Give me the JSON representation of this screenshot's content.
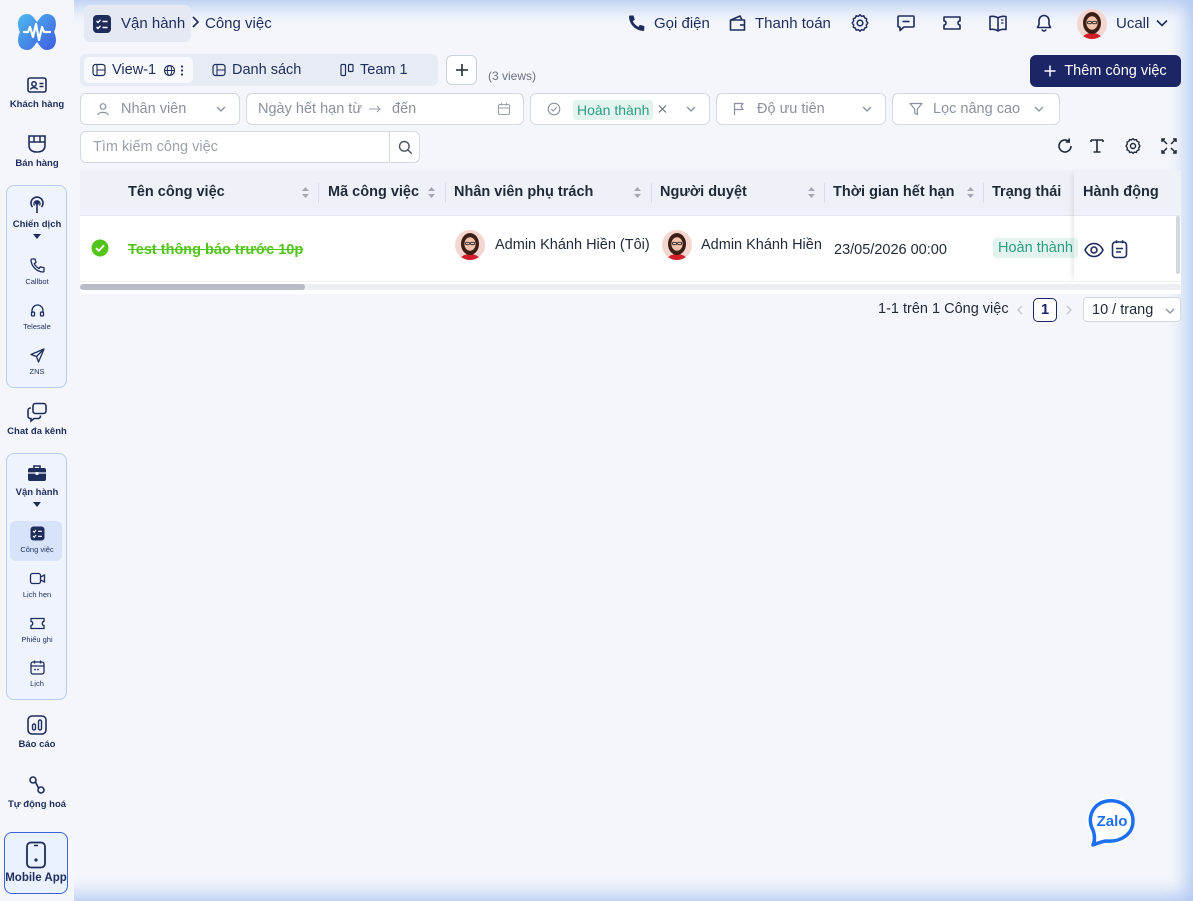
{
  "sidebar": {
    "items": [
      {
        "label": "Khách hàng",
        "icon": "contact-card-icon"
      },
      {
        "label": "Bán hàng",
        "icon": "store-icon"
      },
      {
        "label": "Chiến dịch",
        "icon": "broadcast-icon"
      },
      {
        "label": "Chat đa kênh",
        "icon": "chat-icon"
      },
      {
        "label": "Vận hành",
        "icon": "briefcase-icon"
      },
      {
        "label": "Báo cáo",
        "icon": "report-icon"
      },
      {
        "label": "Tự động hoá",
        "icon": "automation-icon"
      }
    ],
    "campaign_sub": [
      {
        "label": "Callbot",
        "icon": "phone-icon"
      },
      {
        "label": "Telesale",
        "icon": "headset-icon"
      },
      {
        "label": "ZNS",
        "icon": "send-icon"
      }
    ],
    "operation_sub": [
      {
        "label": "Công việc",
        "icon": "checklist-icon",
        "active": true
      },
      {
        "label": "Lịch hẹn",
        "icon": "video-icon"
      },
      {
        "label": "Phiếu ghi",
        "icon": "ticket-icon"
      },
      {
        "label": "Lịch",
        "icon": "calendar-icon"
      }
    ],
    "mobile_app": "Mobile App"
  },
  "header": {
    "breadcrumb_main": "Vận hành",
    "breadcrumb_sub": "Công việc",
    "call_label": "Gọi điện",
    "payment_label": "Thanh toán",
    "user_name": "Ucall"
  },
  "views": {
    "tabs": [
      {
        "label": "View-1",
        "active": true
      },
      {
        "label": "Danh sách"
      },
      {
        "label": "Team 1"
      }
    ],
    "count_label": "(3 views)",
    "add_task_label": "Thêm công việc"
  },
  "filters": {
    "employee_placeholder": "Nhân viên",
    "date_from_placeholder": "Ngày hết hạn từ",
    "date_to_placeholder": "đến",
    "status_value": "Hoàn thành",
    "priority_placeholder": "Độ ưu tiên",
    "advanced_label": "Lọc nâng cao",
    "search_placeholder": "Tìm kiếm công việc"
  },
  "table": {
    "columns": [
      "Tên công việc",
      "Mã công việc",
      "Nhân viên phụ trách",
      "Người duyệt",
      "Thời gian hết hạn",
      "Trạng thái",
      "Hành động"
    ],
    "rows": [
      {
        "name": "Test thông báo trước 10p",
        "code": "",
        "assignee": "Admin Khánh Hiền (Tôi)",
        "approver": "Admin Khánh Hiền",
        "deadline": "23/05/2026 00:00",
        "status": "Hoàn thành"
      }
    ]
  },
  "pagination": {
    "summary": "1-1 trên 1 Công việc",
    "current_page": "1",
    "page_size": "10 / trang"
  },
  "colors": {
    "primary": "#1c2566",
    "done_green": "#52c41a",
    "status_teal": "#2a9d7f"
  },
  "widgets": {
    "zalo_label": "Zalo"
  }
}
